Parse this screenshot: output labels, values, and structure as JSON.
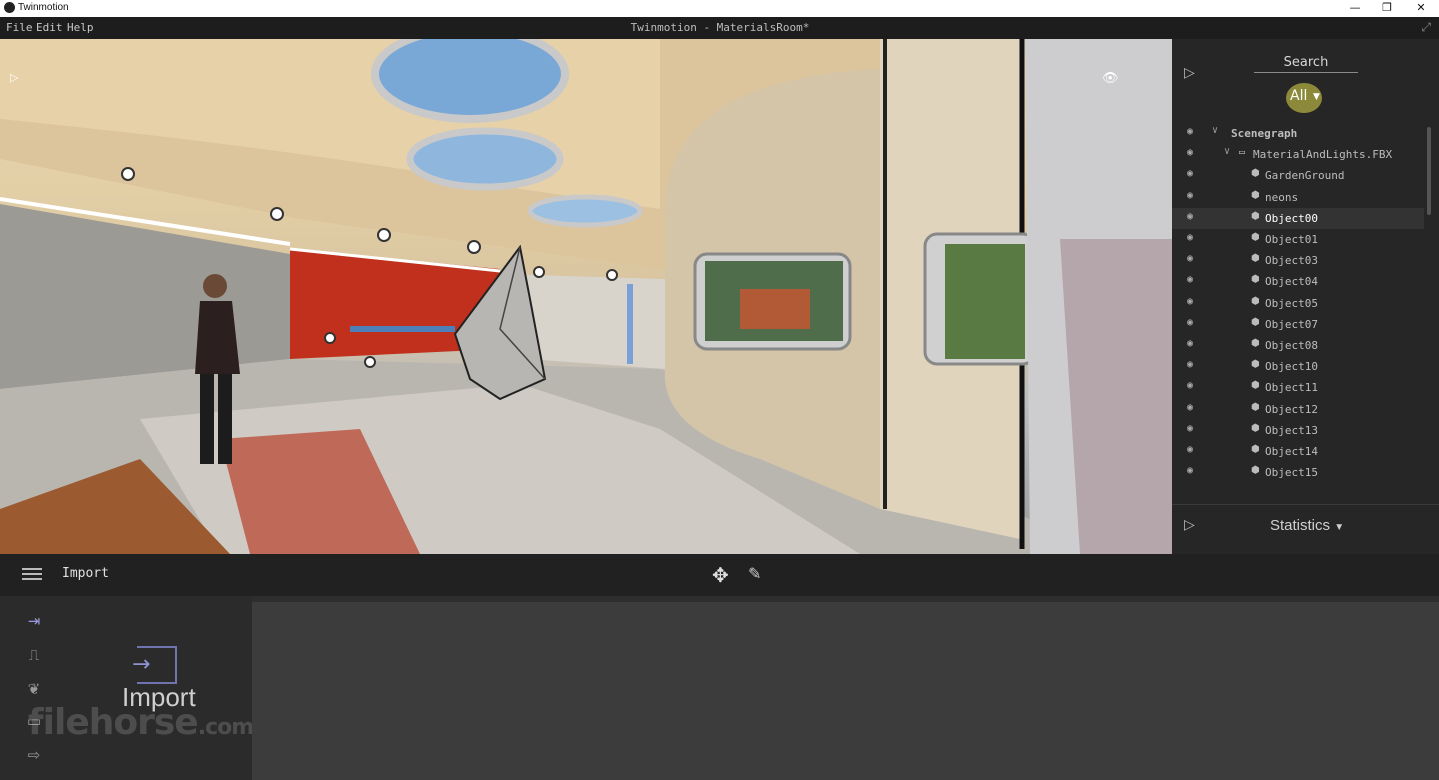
{
  "window": {
    "app_title": "Twinmotion",
    "minimize": "—",
    "maximize": "❐",
    "close": "✕"
  },
  "menu": {
    "items": [
      "File",
      "Edit",
      "Help"
    ],
    "document_title": "Twinmotion - MaterialsRoom*",
    "expand_icon": "⤢"
  },
  "viewport": {
    "collapse_icon": "▷",
    "visibility_icon": "👁"
  },
  "right_panel": {
    "search_label": "Search",
    "filter_label": "All",
    "tree": [
      {
        "label": "Scenegraph",
        "level": 0,
        "type": "root"
      },
      {
        "label": "MaterialAndLights.FBX",
        "level": 1,
        "type": "folder"
      },
      {
        "label": "GardenGround",
        "level": 2,
        "type": "object"
      },
      {
        "label": "neons",
        "level": 2,
        "type": "object"
      },
      {
        "label": "Object00",
        "level": 2,
        "type": "object",
        "selected": true
      },
      {
        "label": "Object01",
        "level": 2,
        "type": "object"
      },
      {
        "label": "Object03",
        "level": 2,
        "type": "object"
      },
      {
        "label": "Object04",
        "level": 2,
        "type": "object"
      },
      {
        "label": "Object05",
        "level": 2,
        "type": "object"
      },
      {
        "label": "Object07",
        "level": 2,
        "type": "object"
      },
      {
        "label": "Object08",
        "level": 2,
        "type": "object"
      },
      {
        "label": "Object10",
        "level": 2,
        "type": "object"
      },
      {
        "label": "Object11",
        "level": 2,
        "type": "object"
      },
      {
        "label": "Object12",
        "level": 2,
        "type": "object"
      },
      {
        "label": "Object13",
        "level": 2,
        "type": "object"
      },
      {
        "label": "Object14",
        "level": 2,
        "type": "object"
      },
      {
        "label": "Object15",
        "level": 2,
        "type": "object"
      }
    ],
    "statistics_label": "Statistics"
  },
  "toolbar": {
    "mode_label": "Import"
  },
  "sidebar": {
    "icons": [
      "import-icon",
      "waveform-icon",
      "leaf-icon",
      "media-icon",
      "export-icon"
    ],
    "big_label": "Import",
    "watermark": "filehorse",
    "watermark_suffix": ".com"
  }
}
